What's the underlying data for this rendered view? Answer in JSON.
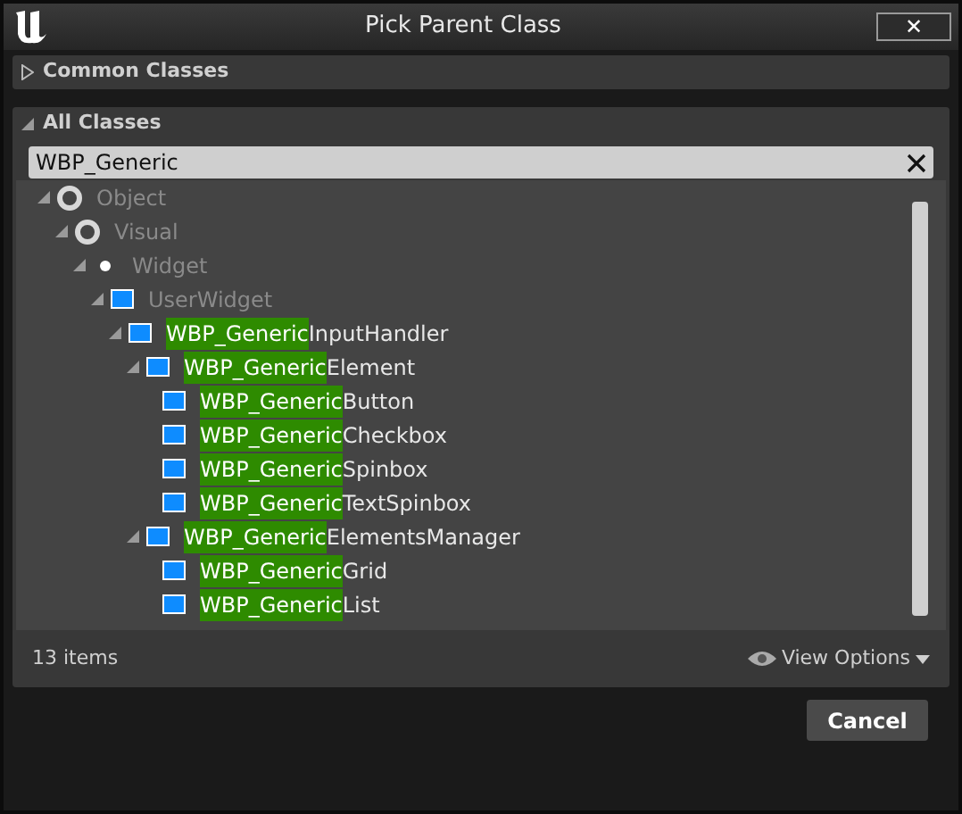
{
  "window": {
    "title": "Pick Parent Class",
    "close_label": "✕"
  },
  "common_classes": {
    "label": "Common Classes",
    "expanded": false
  },
  "all_classes": {
    "label": "All Classes",
    "expanded": true,
    "search": {
      "value": "WBP_Generic"
    },
    "tree": [
      {
        "kind": "circle",
        "label": "Object",
        "dimmed": true,
        "expanded": true,
        "children": [
          {
            "kind": "circle",
            "label": "Visual",
            "dimmed": true,
            "expanded": true,
            "children": [
              {
                "kind": "dot",
                "label": "Widget",
                "dimmed": true,
                "expanded": true,
                "children": [
                  {
                    "kind": "square",
                    "label": "UserWidget",
                    "dimmed": true,
                    "expanded": true,
                    "children": [
                      {
                        "kind": "square",
                        "match": "WBP_Generic",
                        "label": "InputHandler",
                        "dimmed": false,
                        "expanded": true,
                        "children": [
                          {
                            "kind": "square",
                            "match": "WBP_Generic",
                            "label": "Element",
                            "dimmed": false,
                            "expanded": true,
                            "children": [
                              {
                                "kind": "square",
                                "match": "WBP_Generic",
                                "label": "Button",
                                "dimmed": false
                              },
                              {
                                "kind": "square",
                                "match": "WBP_Generic",
                                "label": "Checkbox",
                                "dimmed": false
                              },
                              {
                                "kind": "square",
                                "match": "WBP_Generic",
                                "label": "Spinbox",
                                "dimmed": false
                              },
                              {
                                "kind": "square",
                                "match": "WBP_Generic",
                                "label": "TextSpinbox",
                                "dimmed": false
                              }
                            ]
                          },
                          {
                            "kind": "square",
                            "match": "WBP_Generic",
                            "label": "ElementsManager",
                            "dimmed": false,
                            "expanded": true,
                            "children": [
                              {
                                "kind": "square",
                                "match": "WBP_Generic",
                                "label": "Grid",
                                "dimmed": false
                              },
                              {
                                "kind": "square",
                                "match": "WBP_Generic",
                                "label": "List",
                                "dimmed": false
                              }
                            ]
                          }
                        ]
                      }
                    ]
                  }
                ]
              }
            ]
          }
        ]
      }
    ],
    "item_count": "13 items",
    "view_options": "View Options"
  },
  "buttons": [
    {
      "label": "Cancel"
    }
  ]
}
